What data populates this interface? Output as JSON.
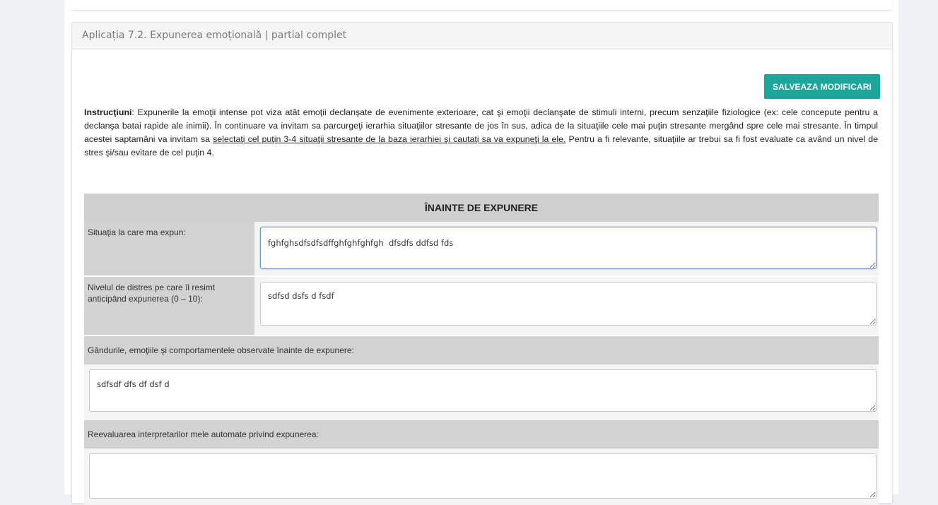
{
  "panel": {
    "title": "Aplicația 7.2. Expunerea emoțională | partial complet"
  },
  "toolbar": {
    "save_label": "SALVEAZA MODIFICARI"
  },
  "instructions": {
    "bold_prefix": "Instrucţiuni",
    "text_1": ": Expunerile la emoţii intense pot viza atât emoţii declanşate de evenimente exterioare, cat şi emoţii declanşate de stimuli interni, precum senzaţiile fiziologice (ex: cele concepute pentru a declanşa batai rapide ale inimii). În continuare va invitam sa parcurgeţi ierarhia situaţiilor stresante de jos în sus, adica de la situaţiile cele mai puţin stresante mergând spre cele mai stresante. În timpul acestei saptamâni va invitam sa ",
    "underlined": "selectaţi cel puţin 3-4 situaţii stresante de la baza ierarhiei şi cautaţi sa va expuneţi la ele.",
    "text_2": " Pentru a fi relevante, situaţiile ar trebui sa fi fost evaluate ca având un nivel de stres şi/sau evitare de cel puţin 4."
  },
  "section": {
    "header": "ÎNAINTE DE EXPUNERE",
    "situation_label": "Situaţia la care ma expun:",
    "situation_value": "fghfghsdfsdfsdffghfghfghfgh  dfsdfs ddfsd fds",
    "distress_label": "Nivelul de distres pe care îl resimt anticipând expunerea (0 – 10):",
    "distress_value": "sdfsd dsfs d fsdf",
    "thoughts_label": "Gândurile, emoţiile şi comportamentele observate înainte de expunere:",
    "thoughts_value": "sdfsdf dfs df dsf d",
    "reevaluation_label": "Reevaluarea interpretarilor mele automate privind expunerea:",
    "reevaluation_value": ""
  }
}
